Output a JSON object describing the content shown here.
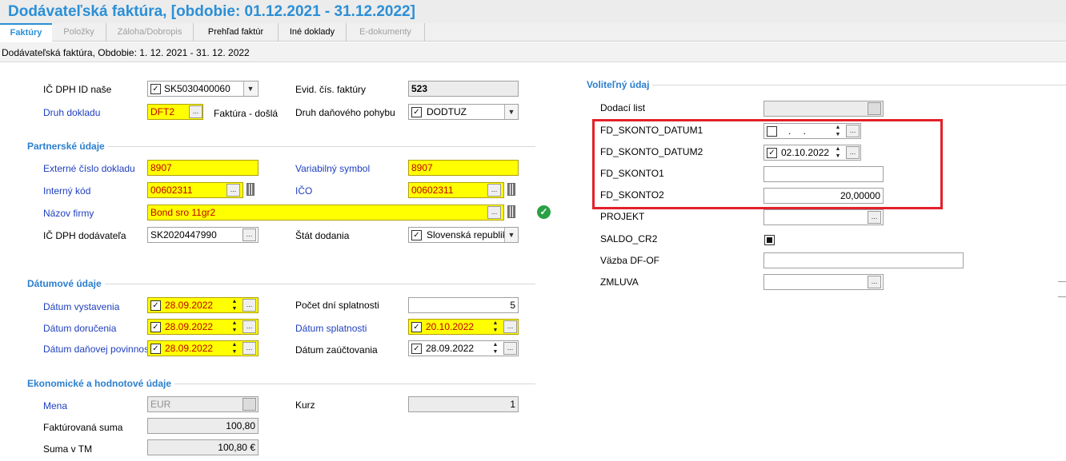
{
  "window": {
    "title": "Dodávateľská faktúra, [obdobie: 01.12.2021 - 31.12.2022]"
  },
  "tabs": [
    {
      "label": "Faktúry",
      "state": "active"
    },
    {
      "label": "Položky",
      "state": "disabled"
    },
    {
      "label": "Záloha/Dobropis",
      "state": "disabled"
    },
    {
      "label": "Prehľad faktúr",
      "state": "enabled"
    },
    {
      "label": "Iné doklady",
      "state": "enabled"
    },
    {
      "label": "E-dokumenty",
      "state": "disabled"
    }
  ],
  "subtitle": "Dodávateľská faktúra, Obdobie: 1. 12. 2021 - 31. 12. 2022",
  "header": {
    "ic_dph_label": "IČ DPH ID naše",
    "ic_dph_value": "SK5030400060",
    "druh_label": "Druh dokladu",
    "druh_value": "DFT2",
    "druh_desc": "Faktúra - došlá",
    "evid_label": "Evid. čís. faktúry",
    "evid_value": "523",
    "dan_pohyb_label": "Druh daňového pohybu",
    "dan_pohyb_value": "DODTUZ"
  },
  "partner": {
    "section": "Partnerské údaje",
    "ext_cislo_label": "Externé číslo dokladu",
    "ext_cislo_value": "8907",
    "var_symbol_label": "Variabilný symbol",
    "var_symbol_value": "8907",
    "interny_kod_label": "Interný kód",
    "interny_kod_value": "00602311",
    "ico_label": "IČO",
    "ico_value": "00602311",
    "nazov_label": "Názov firmy",
    "nazov_value": "Bond sro 11gr2",
    "ic_dph_dod_label": "IČ DPH dodávateľa",
    "ic_dph_dod_value": "SK2020447990",
    "stat_label": "Štát dodania",
    "stat_value": "Slovenská republika"
  },
  "dates": {
    "section": "Dátumové údaje",
    "vystavenia_label": "Dátum vystavenia",
    "vystavenia_value": "28.09.2022",
    "dorucenia_label": "Dátum doručenia",
    "dorucenia_value": "28.09.2022",
    "danovej_label": "Dátum daňovej povinnosti",
    "danovej_value": "28.09.2022",
    "pocet_dni_label": "Počet dní splatnosti",
    "pocet_dni_value": "5",
    "splatnosti_label": "Dátum splatnosti",
    "splatnosti_value": "20.10.2022",
    "zauctovania_label": "Dátum zaúčtovania",
    "zauctovania_value": "28.09.2022"
  },
  "economic": {
    "section": "Ekonomické a hodnotové údaje",
    "mena_label": "Mena",
    "mena_value": "EUR",
    "kurz_label": "Kurz",
    "kurz_value": "1",
    "fakt_suma_label": "Faktúrovaná suma",
    "fakt_suma_value": "100,80",
    "suma_tm_label": "Suma v TM",
    "suma_tm_value": "100,80 €"
  },
  "optional": {
    "section": "Voliteľný údaj",
    "dodaci_list_label": "Dodací list",
    "skonto_datum1_label": "FD_SKONTO_DATUM1",
    "skonto_datum1_value": ". .",
    "skonto_datum2_label": "FD_SKONTO_DATUM2",
    "skonto_datum2_value": "02.10.2022",
    "skonto1_label": "FD_SKONTO1",
    "skonto1_value": "",
    "skonto2_label": "FD_SKONTO2",
    "skonto2_value": "20,00000",
    "projekt_label": "PROJEKT",
    "saldo_label": "SALDO_CR2",
    "vazba_label": "Väzba DF-OF",
    "zmluva_label": "ZMLUVA"
  },
  "colors": {
    "title": "#2b8fd6",
    "required_field_bg": "#ffff00",
    "required_text": "#c00000",
    "link_label": "#1f3fbf",
    "highlight_box": "#e3202a"
  }
}
